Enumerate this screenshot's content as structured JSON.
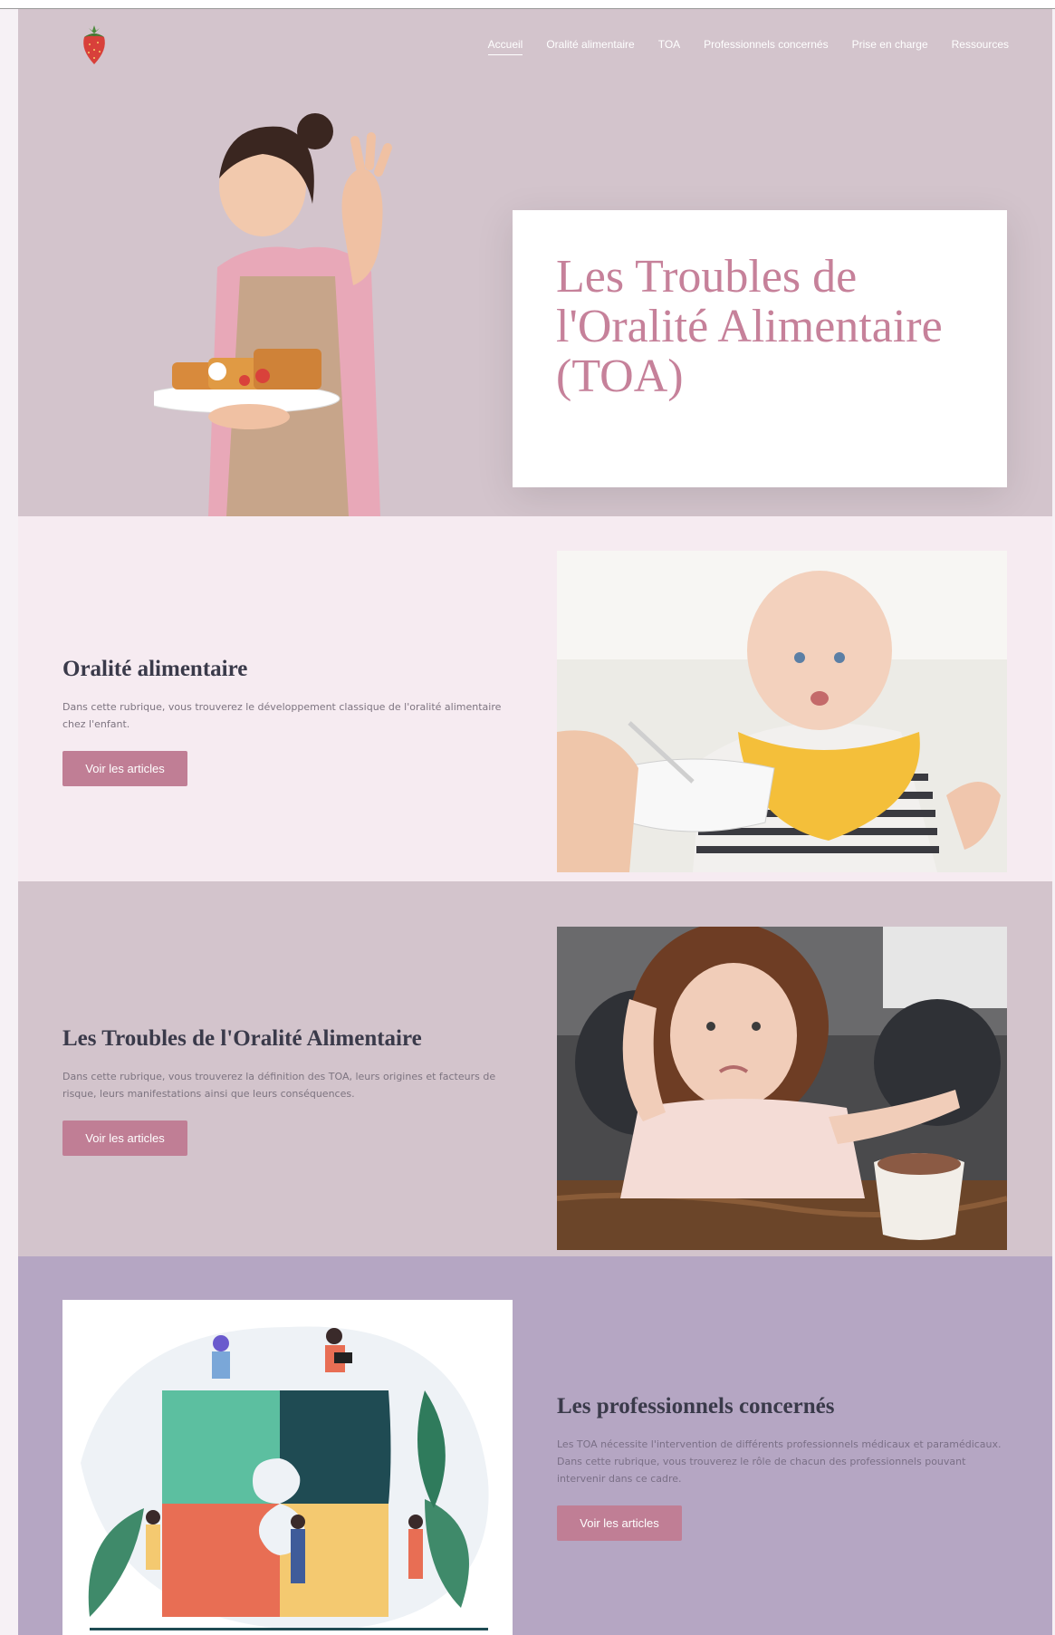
{
  "nav": {
    "logo_icon": "strawberry-icon",
    "items": [
      {
        "label": "Accueil",
        "active": true
      },
      {
        "label": "Oralité alimentaire"
      },
      {
        "label": "TOA"
      },
      {
        "label": "Professionnels concernés"
      },
      {
        "label": "Prise en charge"
      },
      {
        "label": "Ressources"
      }
    ]
  },
  "hero": {
    "title": "Les Troubles de l'Oralité Alimentaire (TOA)"
  },
  "sections": [
    {
      "title": "Oralité alimentaire",
      "text": "Dans cette rubrique, vous trouverez le développement classique de l'oralité alimentaire chez l'enfant.",
      "button": "Voir les articles"
    },
    {
      "title": "Les Troubles de l'Oralité Alimentaire",
      "text": "Dans cette rubrique, vous trouverez la définition des TOA, leurs origines et facteurs de risque, leurs manifestations ainsi que leurs conséquences.",
      "button": "Voir les articles"
    },
    {
      "title": "Les professionnels concernés",
      "text": "Les TOA nécessite l'intervention de différents professionnels médicaux et paramédicaux. Dans cette rubrique, vous trouverez le rôle de chacun des professionnels pouvant intervenir dans ce cadre.",
      "button": "Voir les articles"
    }
  ],
  "colors": {
    "hero_bg": "#d3c4cc",
    "accent": "#c07e95",
    "title_pink": "#c6819a",
    "section_light": "#f6ebf1",
    "section_purple": "#b5a6c3"
  }
}
